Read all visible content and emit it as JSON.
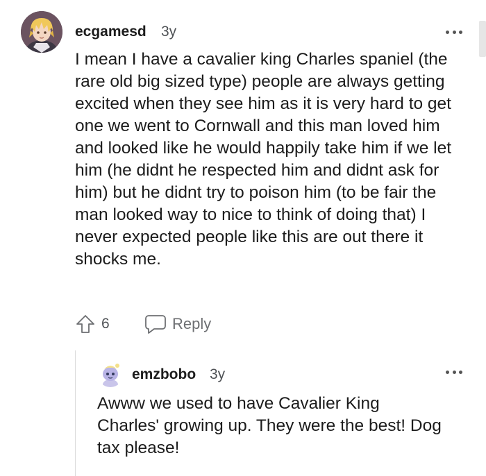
{
  "comments": [
    {
      "username": "ecgamesd",
      "age": "3y",
      "body": "I mean I have a cavalier king Charles spaniel (the rare old big sized type) people are always getting excited when they see him as it is very hard to get one we went to Cornwall and this man loved him and looked like he would happily take him if we let him (he didnt he respected him and didnt ask for him) but he didnt try to poison him (to be fair the man looked way to nice to think of doing that) I never expected people like this are out there it shocks me.",
      "upvotes": "6",
      "reply_label": "Reply",
      "avatar_icon": "avatar-illustrated-blond-character"
    },
    {
      "username": "emzbobo",
      "age": "3y",
      "body": "Awww we used to have Cavalier King Charles' growing up. They were the best! Dog tax please!",
      "avatar_icon": "avatar-snoo-character"
    }
  ],
  "colors": {
    "text": "#1c1c1c",
    "meta": "#4f5256",
    "icon": "#6d6f72",
    "thread_line": "#dcdcdc"
  }
}
